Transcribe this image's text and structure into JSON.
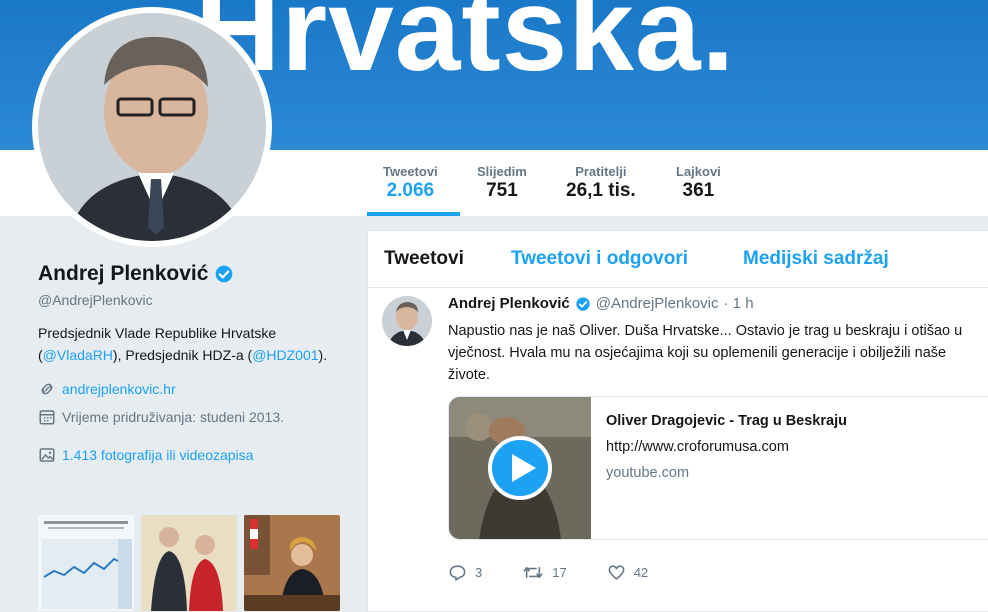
{
  "banner": {
    "text": "Hrvatska."
  },
  "colors": {
    "accent": "#1da1f2",
    "banner": "#1a78c8",
    "text": "#14171a",
    "muted": "#657786"
  },
  "stats": [
    {
      "label": "Tweetovi",
      "value": "2.066"
    },
    {
      "label": "Slijedim",
      "value": "751"
    },
    {
      "label": "Pratitelji",
      "value": "26,1 tis."
    },
    {
      "label": "Lajkovi",
      "value": "361"
    }
  ],
  "profile": {
    "name": "Andrej Plenković",
    "handle": "@AndrejPlenkovic",
    "bio": {
      "text1": "Predsjednik Vlade Republike Hrvatske (",
      "mention1": "@VladaRH",
      "text2": "), Predsjednik HDZ-a (",
      "mention2": "@HDZ001",
      "text3": ")."
    },
    "website": "andrejplenkovic.hr",
    "joined": "Vrijeme pridruživanja: studeni 2013.",
    "media": "1.413 fotografija ili videozapisa"
  },
  "timeline_tabs": [
    "Tweetovi",
    "Tweetovi i odgovori",
    "Medijski sadržaj"
  ],
  "tweet": {
    "name": "Andrej Plenković",
    "handle": "@AndrejPlenkovic",
    "time": "· 1 h",
    "lines": [
      "Napustio nas je naš Oliver. Duša Hrvatske... Ostavio je trag u beskraju i otišao u",
      "vječnost. Hvala mu na osjećajima koji su oplemenili generacije i obilježili naše",
      "živote."
    ],
    "card": {
      "title": "Oliver Dragojevic - Trag u Beskraju",
      "description": "http://www.croforumusa.com",
      "domain": "youtube.com"
    },
    "replies": "3",
    "retweets": "17",
    "likes": "42"
  }
}
